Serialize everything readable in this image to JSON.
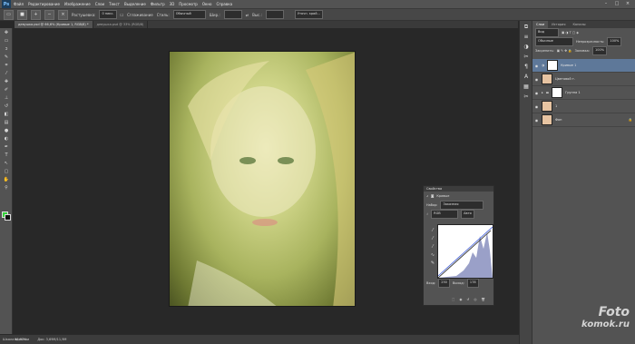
{
  "app": {
    "logo": "Ps"
  },
  "menu": [
    "Файл",
    "Редактирование",
    "Изображение",
    "Слои",
    "Текст",
    "Выделение",
    "Фильтр",
    "3D",
    "Просмотр",
    "Окно",
    "Справка"
  ],
  "options": {
    "feather_label": "Растушевка:",
    "feather_value": "0 пикс.",
    "antialias_label": "Сглаживание",
    "style_label": "Стиль:",
    "style_value": "Обычный",
    "width_label": "Шир.:",
    "height_label": "Выс.:",
    "refine_button": "Уточн. край..."
  },
  "tabs": [
    "девушка.psd @ 66,6% (Кривые 1, RGB/8) *",
    "девушка.psd @ 33% (RGB/8)"
  ],
  "status": {
    "zoom": "66,67%",
    "doc": "Док: 3,69М/11,9М"
  },
  "timeline": {
    "label": "Шкала времени"
  },
  "panels": {
    "tabs": [
      "Слои",
      "История",
      "Каналы"
    ],
    "kind": "Вид",
    "blend": "Обычные",
    "opacity_label": "Непрозрачность:",
    "opacity_value": "100%",
    "lock_label": "Закрепить:",
    "fill_label": "Заливка:",
    "fill_value": "100%"
  },
  "layers": [
    {
      "name": "Кривые 1",
      "selected": true,
      "mask": true
    },
    {
      "name": "Цветовой т.",
      "selected": false,
      "mask": false
    },
    {
      "name": "Группа 1",
      "selected": false,
      "mask": true
    },
    {
      "name": "1",
      "selected": false,
      "mask": false
    },
    {
      "name": "Фон",
      "selected": false,
      "mask": false
    }
  ],
  "properties": {
    "title": "Свойства",
    "section": "Кривые",
    "preset_label": "Набор:",
    "preset_value": "Заказная",
    "channel_value": "RGB",
    "auto_button": "Авто",
    "input_label": "Вход:",
    "input_value": "250",
    "output_label": "Выход:",
    "output_value": "178"
  },
  "watermark": {
    "line1": "Foto",
    "line2": "komok.ru"
  },
  "colors": {
    "foreground": "#35d13a",
    "background": "#111111",
    "selection": "#5e7899"
  }
}
